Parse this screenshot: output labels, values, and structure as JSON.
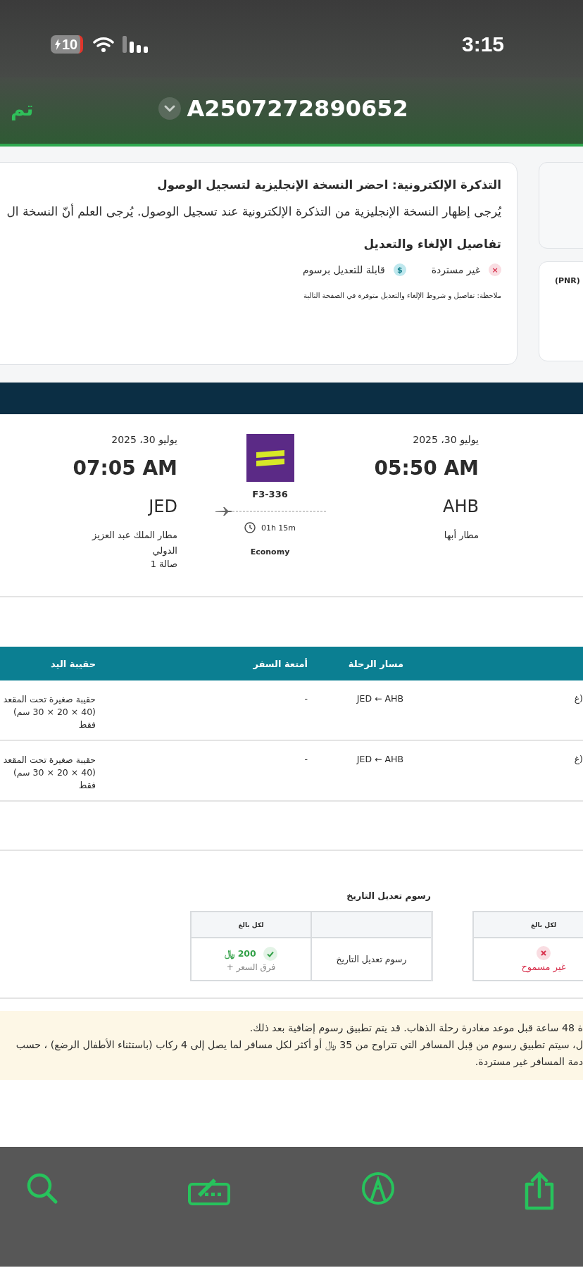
{
  "status_bar": {
    "time": "3:15",
    "battery": "10"
  },
  "nav": {
    "done": "تم",
    "title": "A2507272890652"
  },
  "eticket_card": {
    "title": "التذكرة الإلكترونية: احضر النسخة الإنجليزية لتسجيل الوصول",
    "body": "يُرجى إظهار النسخة الإنجليزية من التذكرة الإلكترونية عند تسجيل الوصول. يُرجى العلم أنّ النسخة ال",
    "policy_title": "تفاصيل الإلغاء والتعديل",
    "policies": [
      {
        "kind": "refund",
        "icon": "×",
        "label": "غير مستردة"
      },
      {
        "kind": "change",
        "icon": "$",
        "label": "قابلة للتعديل برسوم"
      }
    ],
    "note": "ملاحظة: تفاصيل و شروط الإلغاء والتعديل متوفرة في الصفحة التالية"
  },
  "side_card": {
    "label": "(PNR)"
  },
  "flight": {
    "departure": {
      "date": "يوليو 30، 2025",
      "time": "05:50 AM",
      "code": "AHB",
      "airport": "مطار أبها"
    },
    "arrival": {
      "date": "يوليو 30، 2025",
      "time": "07:05 AM",
      "code": "JED",
      "airport": "مطار الملك عبد العزيز الدولي",
      "terminal": "صالة 1"
    },
    "flight_number": "F3-336",
    "duration": "01h 15m",
    "cabin": "Economy"
  },
  "baggage_table": {
    "columns": [
      "مسار الرحلة",
      "أمتعة السفر",
      "حقيبة اليد"
    ],
    "rows": [
      {
        "hand_bag": "حقيبة صغيرة تحت المقعد (40 × 20 × 30 سم) فقط",
        "baggage": "-",
        "route": "JED ← AHB",
        "column_4": "غ)"
      },
      {
        "hand_bag": "حقيبة صغيرة تحت المقعد (40 × 20 × 30 سم) فقط",
        "baggage": "-",
        "route": "JED ← AHB",
        "column_4": "غ)"
      }
    ]
  },
  "change_fees": {
    "title": "رسوم تعديل التاريخ",
    "tables": [
      {
        "header": "لكل بالغ",
        "allowed": false,
        "status": "غير مسموح"
      },
      {
        "header": "لكل بالغ",
        "row_label": "رسوم تعديل التاريخ",
        "allowed": true,
        "amount": "200 ﷼",
        "extra": "+ فرق السعر"
      }
    ]
  },
  "notice_lines": [
    "ة 48 ساعة قبل موعد مغادرة رحلة الذهاب. قد يتم تطبيق رسوم إضافية بعد ذلك.",
    "ل، سيتم تطبيق رسوم من قِبل المسافر التي تتراوح من 35 ﷼ أو أكثر لكل مسافر لما يصل إلى 4 ركاب (باستثناء الأطفال الرضع) ، حسب",
    "دمة المسافر غير مستردة."
  ]
}
